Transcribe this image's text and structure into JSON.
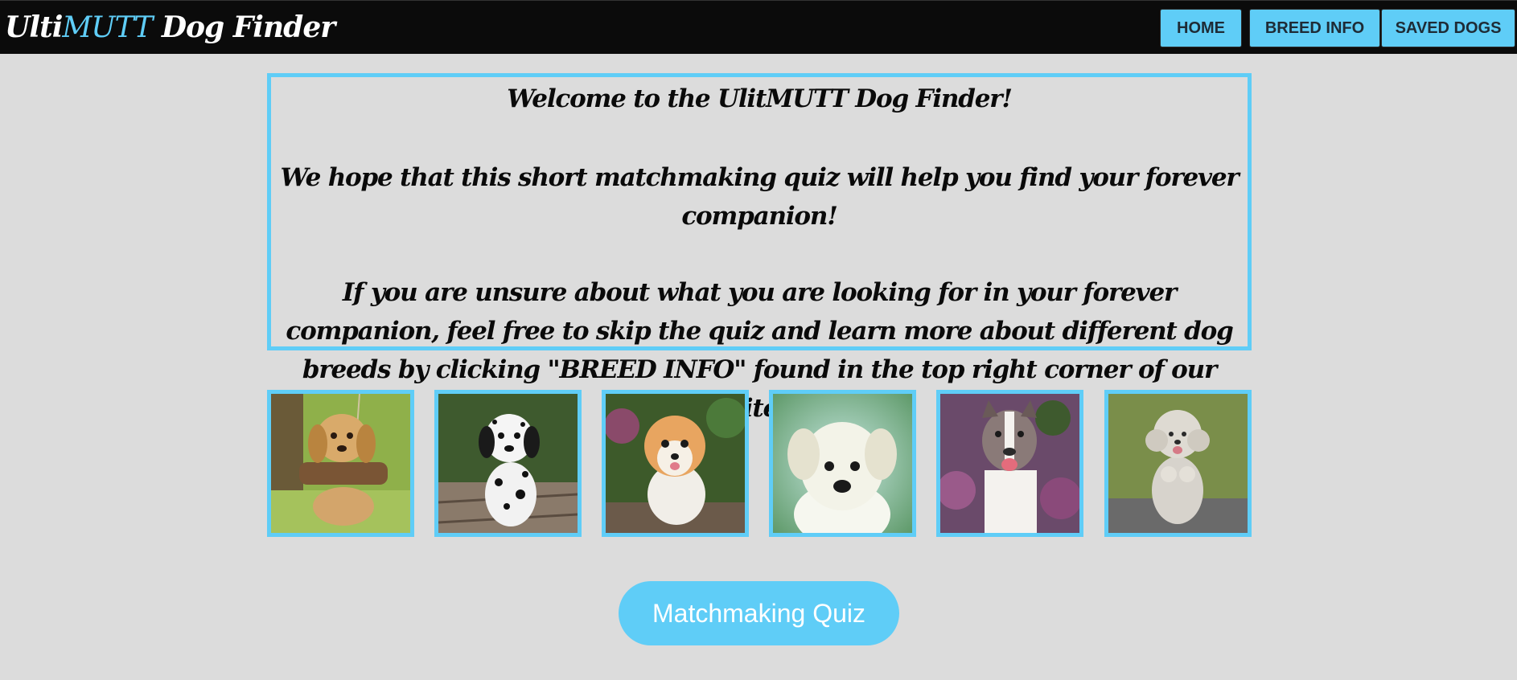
{
  "header": {
    "brand_prefix": "Ulti",
    "brand_accent": "MUTT",
    "brand_suffix": " Dog Finder"
  },
  "nav": {
    "home": "HOME",
    "breed_info": "BREED INFO",
    "saved_dogs": "SAVED DOGS"
  },
  "intro": {
    "welcome": "Welcome to the UlitMUTT Dog Finder!",
    "hope": "We hope that this short matchmaking quiz will help you find your forever companion!",
    "unsure": "If you are unsure about what you are looking for in your forever companion, feel free to skip the quiz and learn more about different dog breeds by clicking \"BREED INFO\" found in the top right corner of our site!"
  },
  "gallery": [
    {
      "name": "golden-puppy-on-swing"
    },
    {
      "name": "dalmatian-puppy"
    },
    {
      "name": "pomeranian"
    },
    {
      "name": "white-puppy"
    },
    {
      "name": "pitbull"
    },
    {
      "name": "poodle-figurine"
    }
  ],
  "cta": {
    "quiz_label": "Matchmaking Quiz"
  },
  "colors": {
    "accent": "#5fcdf7",
    "navbar": "#0b0b0b",
    "background": "#dcdcdc",
    "text": "#0a0a0a"
  }
}
